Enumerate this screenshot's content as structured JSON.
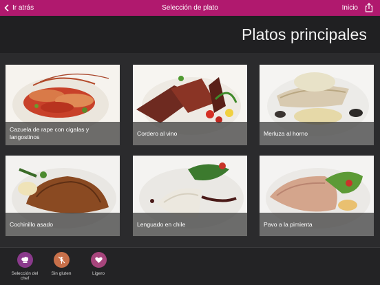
{
  "navbar": {
    "back_label": "Ir atrás",
    "title": "Selección de plato",
    "home_label": "Inicio",
    "accent": "#b0196e"
  },
  "header": {
    "title": "Platos principales"
  },
  "dishes": [
    {
      "name": "Cazuela de rape con cigalas y langostinos"
    },
    {
      "name": "Cordero al vino"
    },
    {
      "name": "Merluza al horno"
    },
    {
      "name": "Cochinillo asado"
    },
    {
      "name": "Lenguado en chile"
    },
    {
      "name": "Pavo a la pimienta"
    }
  ],
  "filters": [
    {
      "label": "Selección del chef",
      "icon": "chef-hat-icon",
      "color": "#8a3a8c"
    },
    {
      "label": "Sin gluten",
      "icon": "no-wheat-icon",
      "color": "#c8704a"
    },
    {
      "label": "Ligero",
      "icon": "heart-icon",
      "color": "#a7457c"
    }
  ]
}
